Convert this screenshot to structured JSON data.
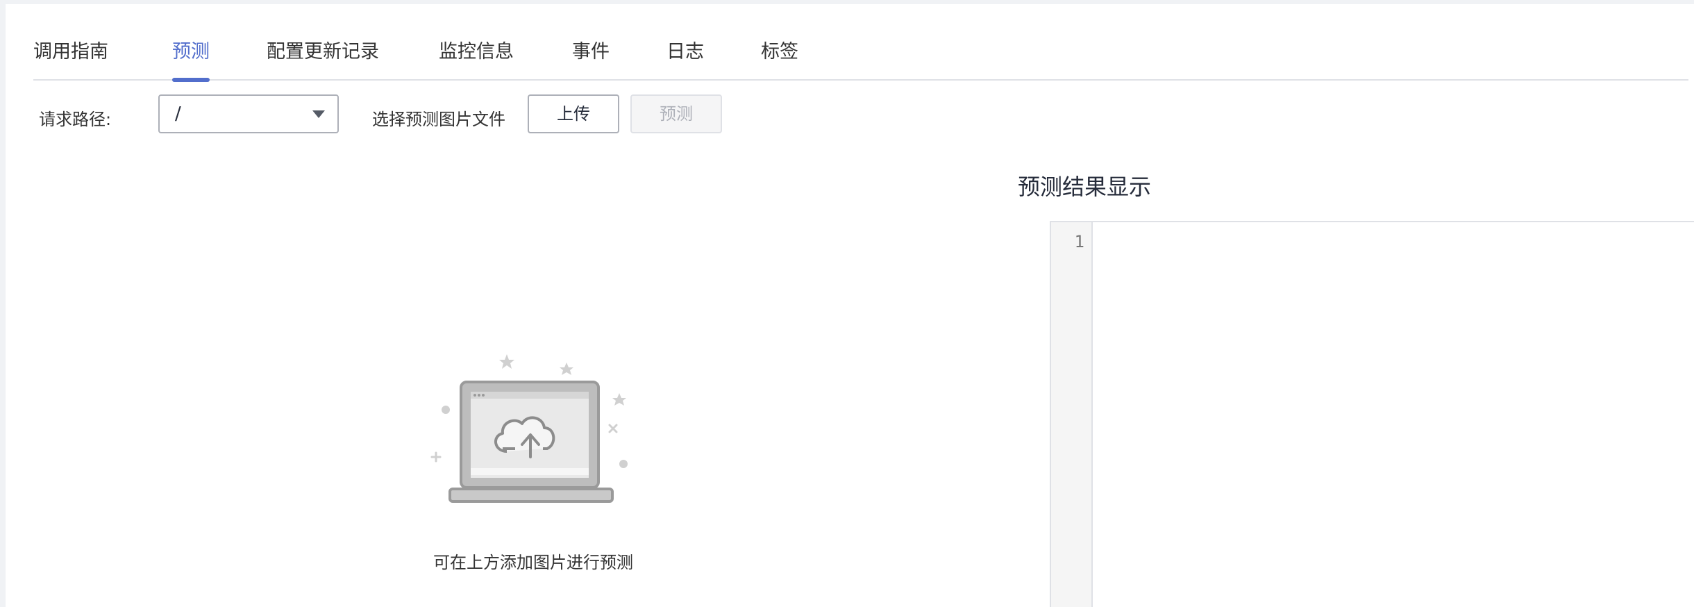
{
  "tabs": [
    {
      "label": "调用指南",
      "active": false
    },
    {
      "label": "预测",
      "active": true
    },
    {
      "label": "配置更新记录",
      "active": false
    },
    {
      "label": "监控信息",
      "active": false
    },
    {
      "label": "事件",
      "active": false
    },
    {
      "label": "日志",
      "active": false
    },
    {
      "label": "标签",
      "active": false
    }
  ],
  "toolbar": {
    "path_label": "请求路径:",
    "path_value": "/",
    "file_label": "选择预测图片文件",
    "upload_label": "上传",
    "predict_label": "预测",
    "predict_disabled": true
  },
  "empty_state": {
    "message": "可在上方添加图片进行预测",
    "icon": "laptop-cloud-upload-icon"
  },
  "result": {
    "title": "预测结果显示",
    "line_numbers": [
      "1"
    ]
  },
  "colors": {
    "accent": "#526ecc",
    "border": "#adb0b8",
    "disabled_text": "#adb0b8"
  }
}
